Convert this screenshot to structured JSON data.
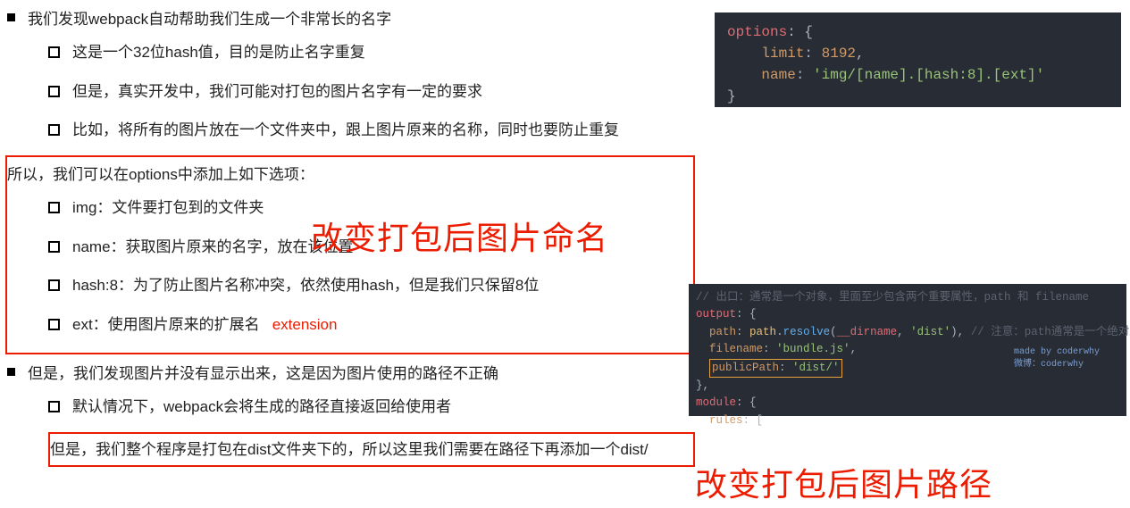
{
  "bullets": {
    "b1": "我们发现webpack自动帮助我们生成一个非常长的名字",
    "b1_1": "这是一个32位hash值，目的是防止名字重复",
    "b1_2": "但是，真实开发中，我们可能对打包的图片名字有一定的要求",
    "b1_3": "比如，将所有的图片放在一个文件夹中，跟上图片原来的名称，同时也要防止重复",
    "b2": "所以，我们可以在options中添加上如下选项：",
    "b2_1": "img：文件要打包到的文件夹",
    "b2_2": "name：获取图片原来的名字，放在该位置",
    "b2_3": "hash:8：为了防止图片名称冲突，依然使用hash，但是我们只保留8位",
    "b2_4": "ext：使用图片原来的扩展名",
    "b2_4_note": "extension",
    "b3": "但是，我们发现图片并没有显示出来，这是因为图片使用的路径不正确",
    "b3_1": "默认情况下，webpack会将生成的路径直接返回给使用者",
    "b3_2": "但是，我们整个程序是打包在dist文件夹下的，所以这里我们需要在路径下再添加一个dist/"
  },
  "annotations": {
    "a1": "改变打包后图片命名",
    "a2": "改变打包后图片路径"
  },
  "code1": {
    "options": "options",
    "limit_key": "limit",
    "limit_val": "8192",
    "name_key": "name",
    "name_val": "'img/[name].[hash:8].[ext]'"
  },
  "code2": {
    "comment_top": "// 出口：通常是一个对象，里面至少包含两个重要属性，path 和 filename",
    "output": "output",
    "path_key": "path",
    "path_obj": "path",
    "resolve": "resolve",
    "dirname": "__dirname",
    "dist": "'dist'",
    "path_comment": "// 注意：path通常是一个绝对路径",
    "filename_key": "filename",
    "filename_val": "'bundle.js'",
    "publicPath_key": "publicPath",
    "publicPath_val": "'dist/'",
    "module": "module",
    "rules": "rules",
    "watermark_l1": "made by coderwhy",
    "watermark_l2": "微博：coderwhy"
  }
}
